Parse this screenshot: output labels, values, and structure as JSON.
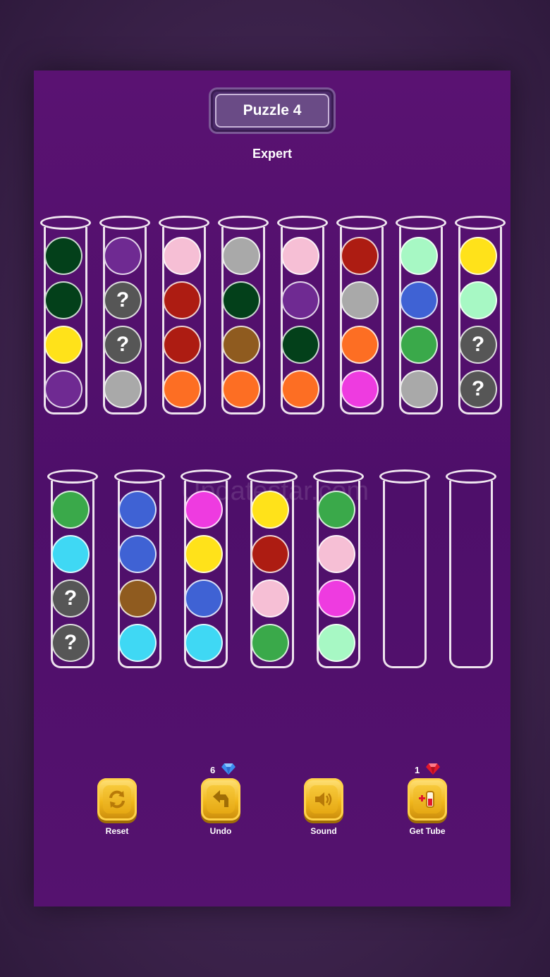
{
  "header": {
    "title": "Puzzle 4",
    "difficulty": "Expert"
  },
  "watermark": "Updatestar.com",
  "colors": {
    "dark-green": "#03401a",
    "purple": "#6f2a92",
    "pink": "#f6bfd5",
    "gray": "#a9a9a9",
    "red": "#ad1c12",
    "mint": "#a7f8c4",
    "yellow": "#ffe21a",
    "blue": "#3f62d4",
    "green": "#3aa94a",
    "orange": "#fd6e23",
    "brown": "#8f5b1f",
    "magenta": "#ee3be0",
    "cyan": "#3fd8f4",
    "hidden": "#565656"
  },
  "tubes": [
    {
      "balls": [
        "dark-green",
        "dark-green",
        "yellow",
        "purple"
      ]
    },
    {
      "balls": [
        "purple",
        "hidden",
        "hidden",
        "gray"
      ]
    },
    {
      "balls": [
        "pink",
        "red",
        "red",
        "orange"
      ]
    },
    {
      "balls": [
        "gray",
        "dark-green",
        "brown",
        "orange"
      ]
    },
    {
      "balls": [
        "pink",
        "purple",
        "dark-green",
        "orange"
      ]
    },
    {
      "balls": [
        "red",
        "gray",
        "orange",
        "magenta"
      ]
    },
    {
      "balls": [
        "mint",
        "blue",
        "green",
        "gray"
      ]
    },
    {
      "balls": [
        "yellow",
        "mint",
        "hidden",
        "hidden"
      ]
    },
    {
      "balls": [
        "green",
        "cyan",
        "hidden",
        "hidden"
      ]
    },
    {
      "balls": [
        "blue",
        "blue",
        "brown",
        "cyan"
      ]
    },
    {
      "balls": [
        "magenta",
        "yellow",
        "blue",
        "cyan"
      ]
    },
    {
      "balls": [
        "yellow",
        "red",
        "pink",
        "green"
      ]
    },
    {
      "balls": [
        "green",
        "pink",
        "magenta",
        "mint"
      ]
    },
    {
      "balls": []
    },
    {
      "balls": []
    }
  ],
  "hidden_mark": "?",
  "toolbar": {
    "reset_label": "Reset",
    "undo_label": "Undo",
    "undo_count": "6",
    "sound_label": "Sound",
    "get_tube_label": "Get Tube",
    "get_tube_count": "1"
  }
}
